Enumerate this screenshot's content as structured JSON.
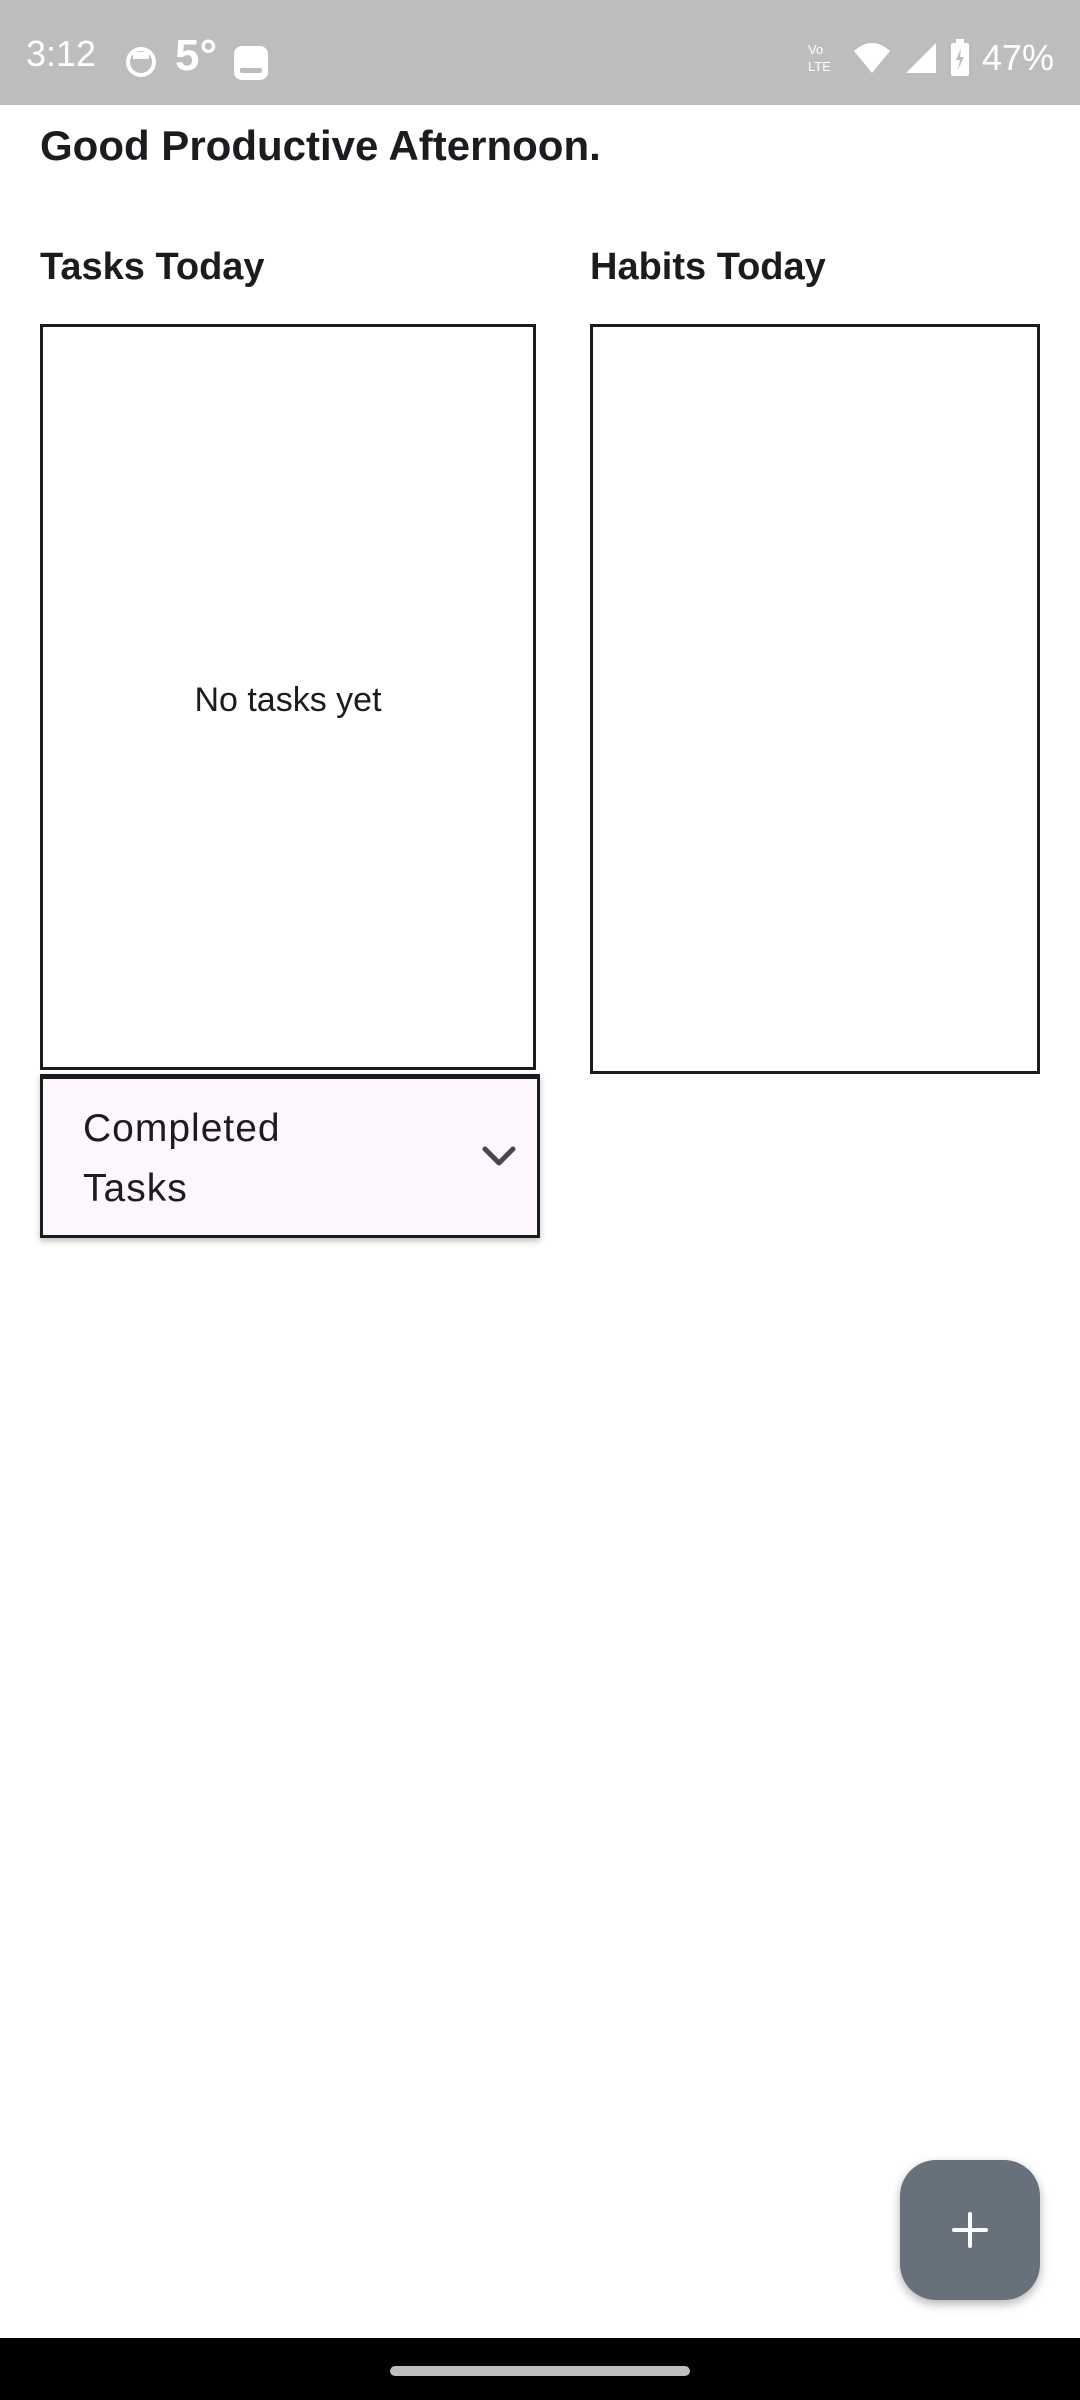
{
  "status_bar": {
    "time": "3:12",
    "temperature": "5°",
    "battery": "47%",
    "network_label": "Vo LTE",
    "icons": [
      "app-notification-icon",
      "gallery-icon",
      "volte-icon",
      "wifi-icon",
      "signal-icon",
      "battery-icon"
    ]
  },
  "greeting": "Good Productive Afternoon.",
  "tasks": {
    "title": "Tasks Today",
    "empty_message": "No tasks yet"
  },
  "habits": {
    "title": "Habits Today"
  },
  "completed": {
    "label": "Completed Tasks",
    "icon": "chevron-down-icon"
  },
  "fab": {
    "icon": "plus-icon"
  },
  "colors": {
    "status_bar": "#bdbdbd",
    "panel_background": "#fdf6fe",
    "fab": "#67717b",
    "text": "#1c1b1f"
  }
}
